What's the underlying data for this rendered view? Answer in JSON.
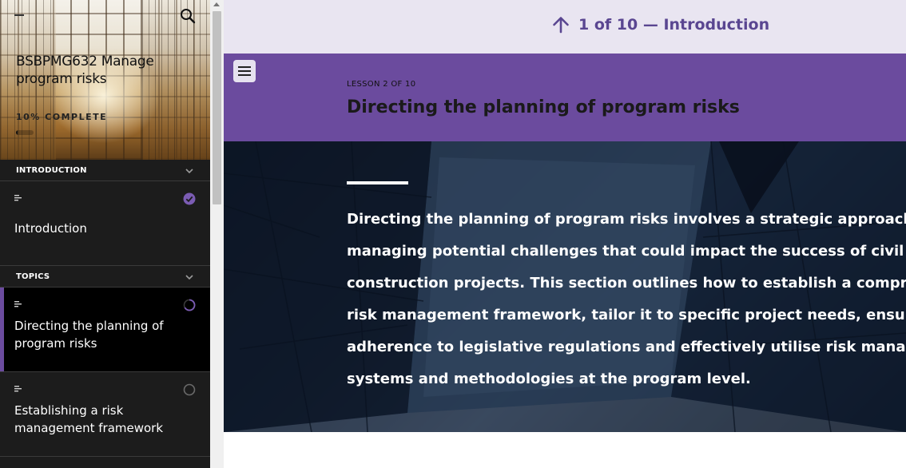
{
  "sidebar": {
    "course_title": "BSBPMG632 Manage program risks",
    "progress_label": "10% COMPLETE",
    "progress_fraction": 0.1,
    "sections": [
      {
        "label": "INTRODUCTION",
        "lessons": [
          {
            "title": "Introduction",
            "status": "complete"
          }
        ]
      },
      {
        "label": "TOPICS",
        "lessons": [
          {
            "title": "Directing the planning of program risks",
            "status": "in-progress"
          },
          {
            "title": "Establishing a risk management framework",
            "status": "not-started"
          }
        ]
      }
    ]
  },
  "topnav": {
    "label": "1 of 10 — Introduction"
  },
  "lesson": {
    "count_label": "LESSON 2 OF 10",
    "title": "Directing the planning of program risks",
    "intro_lines": [
      "Directing the planning of program risks involves a strategic approach to",
      "managing potential challenges that could impact the success of civil",
      "construction projects. This section outlines how to establish a comprehen",
      "risk management framework, tailor it to specific project needs, ensure",
      "adherence to legislative regulations and effectively utilise risk managem",
      "systems and methodologies at the program level."
    ]
  },
  "colors": {
    "accent_purple": "#6b4b9e",
    "nav_bg": "#e9e5f1",
    "nav_text": "#5a4691",
    "sidebar_bg": "#1c1c1c"
  },
  "icons": {
    "search": "search-icon",
    "chevron": "chevron-down-icon",
    "lesson_type": "text-lines-icon",
    "complete": "check-circle-icon",
    "in_progress": "progress-ring-icon",
    "not_started": "empty-circle-icon",
    "arrow_up": "arrow-up-icon",
    "menu": "hamburger-icon"
  }
}
